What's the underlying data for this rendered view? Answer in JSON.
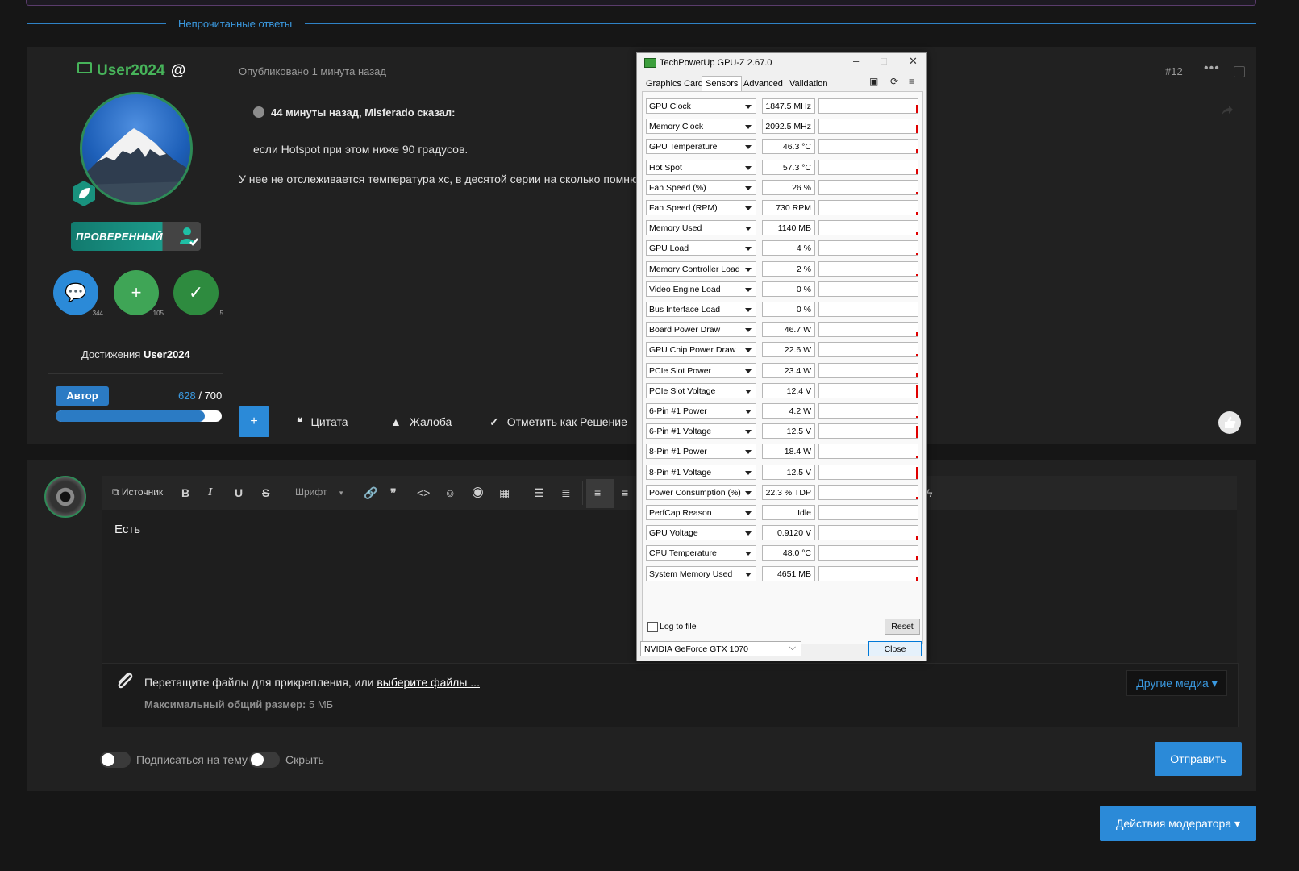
{
  "header": {
    "section_label": "Непрочитанные ответы"
  },
  "post": {
    "username": "User2024",
    "username_suffix": "@",
    "published": "Опубликовано 1 минута назад",
    "post_number": "#12",
    "more_label": "•••",
    "verified_label": "ПРОВЕРЕННЫЙ",
    "counters": [
      {
        "icon": "chat-icon",
        "count": "344",
        "color": "#2b8ad8"
      },
      {
        "icon": "plus-icon",
        "count": "105",
        "color": "#3fa556"
      },
      {
        "icon": "check-icon",
        "count": "5",
        "color": "#2e8b3f"
      }
    ],
    "achievements_prefix": "Достижения",
    "achievements_user": "User2024",
    "rank_label": "Автор",
    "score_current": "628",
    "score_max": "/ 700",
    "score_fraction": 0.897,
    "quote_header": "44 минуты назад, Misferado сказал:",
    "quote_text": "если Hotspot при этом ниже 90 градусов.",
    "body_text": "У нее не отслеживается температура хс, в десятой серии на сколько помню",
    "actions": {
      "plus": "+",
      "quote": "Цитата",
      "report": "Жалоба",
      "solution": "Отметить как Решение"
    }
  },
  "editor": {
    "toolbar": {
      "source": "Источник",
      "bold": "B",
      "italic": "I",
      "underline": "U",
      "strike": "S",
      "font": "Шрифт"
    },
    "content": "Есть",
    "attach_text": "Перетащите файлы для прикрепления, или",
    "attach_link": "выберите файлы ...",
    "max_size_label": "Максимальный общий размер:",
    "max_size_value": "5 МБ",
    "other_media": "Другие медиа ▾",
    "subscribe_label": "Подписаться на тему",
    "hide_label": "Скрыть",
    "send_label": "Отправить"
  },
  "moderator_actions": "Действия модератора ▾",
  "gpuz": {
    "title": "TechPowerUp GPU-Z 2.67.0",
    "tabs": [
      "Graphics Card",
      "Sensors",
      "Advanced",
      "Validation"
    ],
    "active_tab": "Sensors",
    "sensors": [
      {
        "name": "GPU Clock",
        "value": "1847.5 MHz",
        "spike": 0.6
      },
      {
        "name": "Memory Clock",
        "value": "2092.5 MHz",
        "spike": 0.6
      },
      {
        "name": "GPU Temperature",
        "value": "46.3 °C",
        "spike": 0.3
      },
      {
        "name": "Hot Spot",
        "value": "57.3 °C",
        "spike": 0.4
      },
      {
        "name": "Fan Speed (%)",
        "value": "26 %",
        "spike": 0.2
      },
      {
        "name": "Fan Speed (RPM)",
        "value": "730 RPM",
        "spike": 0.2
      },
      {
        "name": "Memory Used",
        "value": "1140 MB",
        "spike": 0.2
      },
      {
        "name": "GPU Load",
        "value": "4 %",
        "spike": 0.05
      },
      {
        "name": "Memory Controller Load",
        "value": "2 %",
        "spike": 0.05
      },
      {
        "name": "Video Engine Load",
        "value": "0 %",
        "spike": 0
      },
      {
        "name": "Bus Interface Load",
        "value": "0 %",
        "spike": 0
      },
      {
        "name": "Board Power Draw",
        "value": "46.7 W",
        "spike": 0.3
      },
      {
        "name": "GPU Chip Power Draw",
        "value": "22.6 W",
        "spike": 0.2
      },
      {
        "name": "PCIe Slot Power",
        "value": "23.4 W",
        "spike": 0.3
      },
      {
        "name": "PCIe Slot Voltage",
        "value": "12.4 V",
        "spike": 0.9
      },
      {
        "name": "6-Pin #1 Power",
        "value": "4.2 W",
        "spike": 0.1
      },
      {
        "name": "6-Pin #1 Voltage",
        "value": "12.5 V",
        "spike": 0.9
      },
      {
        "name": "8-Pin #1 Power",
        "value": "18.4 W",
        "spike": 0.2
      },
      {
        "name": "8-Pin #1 Voltage",
        "value": "12.5 V",
        "spike": 0.9
      },
      {
        "name": "Power Consumption (%)",
        "value": "22.3 % TDP",
        "spike": 0.2
      },
      {
        "name": "PerfCap Reason",
        "value": "Idle",
        "spike": 0
      },
      {
        "name": "GPU Voltage",
        "value": "0.9120 V",
        "spike": 0.3
      },
      {
        "name": "CPU Temperature",
        "value": "48.0 °C",
        "spike": 0.3
      },
      {
        "name": "System Memory Used",
        "value": "4651 MB",
        "spike": 0.3
      }
    ],
    "log_label": "Log to file",
    "reset_label": "Reset",
    "gpu_select": "NVIDIA GeForce GTX 1070",
    "close_label": "Close"
  }
}
